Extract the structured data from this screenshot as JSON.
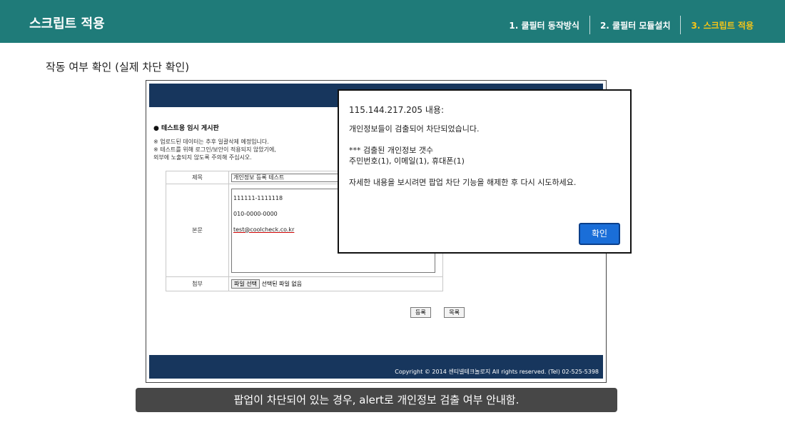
{
  "header": {
    "title": "스크립트 적용",
    "steps": [
      "1. 쿨필터 동작방식",
      "2. 쿨필터 모듈설치",
      "3. 스크립트 적용"
    ],
    "active_color": "#f5c518",
    "bg_color": "#1f7b79"
  },
  "subtitle": "작동 여부 확인 (실제 차단 확인)",
  "screenshot": {
    "board_title": "● 테스트용 임시 게시판",
    "notice": [
      "※ 업로드된 데이터는 추후 일괄삭제 예정입니다.",
      "※ 테스트를 위해 로그인/보안이 적용되지 않았기에,",
      "외부에 노출되지 않도록 주의해 주십시오."
    ],
    "form": {
      "subject_label": "제목",
      "subject_value": "개인정보 등록 테스트",
      "body_label": "본문",
      "body_lines": [
        "111111-1111118",
        "010-0000-0000"
      ],
      "body_email": "test@coolcheck.co.kr",
      "file_label": "첨부",
      "file_button": "파일 선택",
      "file_status": "선택된 파일 없음"
    },
    "buttons": [
      "등록",
      "목록"
    ],
    "footer": "Copyright © 2014 센티넬테크놀로지 All rights reserved. (Tel) 02-525-5398"
  },
  "alert": {
    "host": "115.144.217.205 내용:",
    "line1": "개인정보들이 검출되어 차단되었습니다.",
    "line2": "*** 검출된 개인정보 갯수",
    "line3": "주민번호(1), 이메일(1), 휴대폰(1)",
    "line4": "자세한 내용을 보시려면 팝업 차단 기능을 해제한 후 다시 시도하세요.",
    "ok": "확인"
  },
  "caption": "팝업이 차단되어 있는 경우, alert로 개인정보 검출 여부 안내함."
}
